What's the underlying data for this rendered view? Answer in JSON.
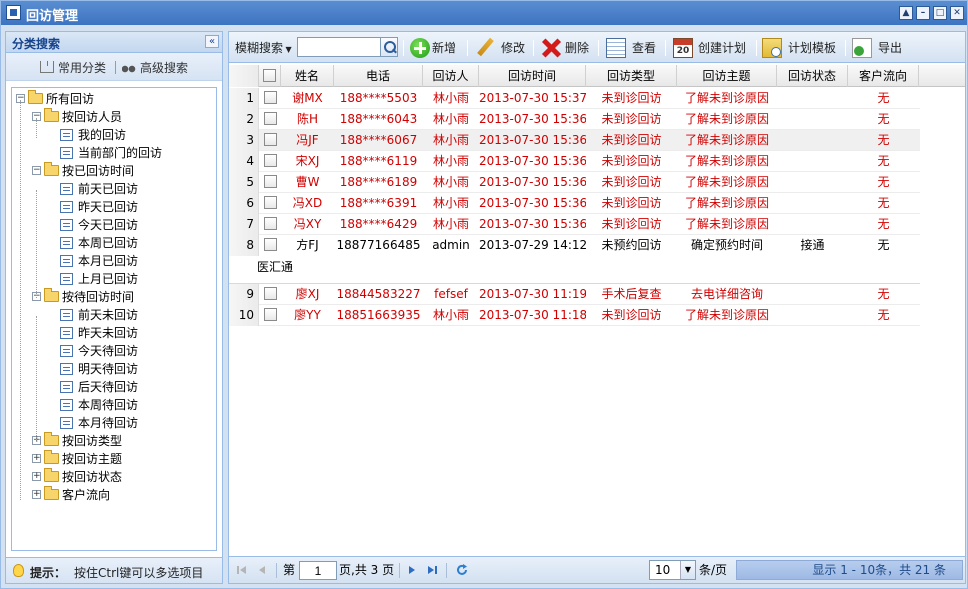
{
  "window": {
    "title": "回访管理"
  },
  "left": {
    "title": "分类搜索",
    "common_label": "常用分类",
    "advanced_label": "高级搜索",
    "tree": [
      {
        "label": "所有回访",
        "level": 0,
        "type": "folder",
        "expander": "−"
      },
      {
        "label": "按回访人员",
        "level": 1,
        "type": "folder",
        "expander": "−"
      },
      {
        "label": "我的回访",
        "level": 2,
        "type": "leaf"
      },
      {
        "label": "当前部门的回访",
        "level": 2,
        "type": "leaf"
      },
      {
        "label": "按已回访时间",
        "level": 1,
        "type": "folder",
        "expander": "−"
      },
      {
        "label": "前天已回访",
        "level": 2,
        "type": "leaf"
      },
      {
        "label": "昨天已回访",
        "level": 2,
        "type": "leaf"
      },
      {
        "label": "今天已回访",
        "level": 2,
        "type": "leaf"
      },
      {
        "label": "本周已回访",
        "level": 2,
        "type": "leaf"
      },
      {
        "label": "本月已回访",
        "level": 2,
        "type": "leaf"
      },
      {
        "label": "上月已回访",
        "level": 2,
        "type": "leaf"
      },
      {
        "label": "按待回访时间",
        "level": 1,
        "type": "folder",
        "expander": "−"
      },
      {
        "label": "前天未回访",
        "level": 2,
        "type": "leaf"
      },
      {
        "label": "昨天未回访",
        "level": 2,
        "type": "leaf"
      },
      {
        "label": "今天待回访",
        "level": 2,
        "type": "leaf"
      },
      {
        "label": "明天待回访",
        "level": 2,
        "type": "leaf"
      },
      {
        "label": "后天待回访",
        "level": 2,
        "type": "leaf"
      },
      {
        "label": "本周待回访",
        "level": 2,
        "type": "leaf"
      },
      {
        "label": "本月待回访",
        "level": 2,
        "type": "leaf"
      },
      {
        "label": "按回访类型",
        "level": 1,
        "type": "folder",
        "expander": "+"
      },
      {
        "label": "按回访主题",
        "level": 1,
        "type": "folder",
        "expander": "+"
      },
      {
        "label": "按回访状态",
        "level": 1,
        "type": "folder",
        "expander": "+"
      },
      {
        "label": "客户流向",
        "level": 1,
        "type": "folder",
        "expander": "+"
      }
    ],
    "hint_label": "提示：",
    "hint_text": "按住Ctrl键可以多选项目"
  },
  "toolbar": {
    "search_label": "模糊搜索",
    "search_value": "",
    "add": "新增",
    "edit": "修改",
    "delete": "删除",
    "view": "查看",
    "create_plan": "创建计划",
    "plan_template": "计划模板",
    "export": "导出"
  },
  "grid": {
    "columns": [
      "姓名",
      "电话",
      "回访人",
      "回访时间",
      "回访类型",
      "回访主题",
      "回访状态",
      "客户流向"
    ],
    "rows": [
      {
        "n": "1",
        "name": "谢MX",
        "phone": "188****5503",
        "person": "林小雨",
        "time": "2013-07-30 15:37",
        "type": "未到诊回访",
        "topic": "了解未到诊原因",
        "status": "",
        "flow": "无",
        "red": true
      },
      {
        "n": "2",
        "name": "陈H",
        "phone": "188****6043",
        "person": "林小雨",
        "time": "2013-07-30 15:36",
        "type": "未到诊回访",
        "topic": "了解未到诊原因",
        "status": "",
        "flow": "无",
        "red": true
      },
      {
        "n": "3",
        "name": "冯JF",
        "phone": "188****6067",
        "person": "林小雨",
        "time": "2013-07-30 15:36",
        "type": "未到诊回访",
        "topic": "了解未到诊原因",
        "status": "",
        "flow": "无",
        "red": true,
        "hl": true
      },
      {
        "n": "4",
        "name": "宋XJ",
        "phone": "188****6119",
        "person": "林小雨",
        "time": "2013-07-30 15:36",
        "type": "未到诊回访",
        "topic": "了解未到诊原因",
        "status": "",
        "flow": "无",
        "red": true
      },
      {
        "n": "5",
        "name": "曹W",
        "phone": "188****6189",
        "person": "林小雨",
        "time": "2013-07-30 15:36",
        "type": "未到诊回访",
        "topic": "了解未到诊原因",
        "status": "",
        "flow": "无",
        "red": true
      },
      {
        "n": "6",
        "name": "冯XD",
        "phone": "188****6391",
        "person": "林小雨",
        "time": "2013-07-30 15:36",
        "type": "未到诊回访",
        "topic": "了解未到诊原因",
        "status": "",
        "flow": "无",
        "red": true
      },
      {
        "n": "7",
        "name": "冯XY",
        "phone": "188****6429",
        "person": "林小雨",
        "time": "2013-07-30 15:36",
        "type": "未到诊回访",
        "topic": "了解未到诊原因",
        "status": "",
        "flow": "无",
        "red": true
      },
      {
        "n": "8",
        "name": "方FJ",
        "phone": "18877166485",
        "person": "admin",
        "time": "2013-07-29 14:12",
        "type": "未预约回访",
        "topic": "确定预约时间",
        "status": "接通",
        "flow": "无",
        "red": false,
        "detail": "医汇通"
      },
      {
        "n": "9",
        "name": "廖XJ",
        "phone": "18844583227",
        "person": "fefsef",
        "time": "2013-07-30 11:19",
        "type": "手术后复查",
        "topic": "去电详细咨询",
        "status": "",
        "flow": "无",
        "red": true
      },
      {
        "n": "10",
        "name": "廖YY",
        "phone": "18851663935",
        "person": "林小雨",
        "time": "2013-07-30 11:18",
        "type": "未到诊回访",
        "topic": "了解未到诊原因",
        "status": "",
        "flow": "无",
        "red": true
      }
    ]
  },
  "pager": {
    "page_prefix": "第",
    "page_value": "1",
    "page_suffix": "页,共 3 页",
    "page_size": "10",
    "page_size_suffix": "条/页",
    "status": "显示 1 - 10条，共 21 条"
  },
  "colors": {
    "red_text": "#d00000",
    "title_blue": "#15428b",
    "border": "#99bbe8"
  }
}
